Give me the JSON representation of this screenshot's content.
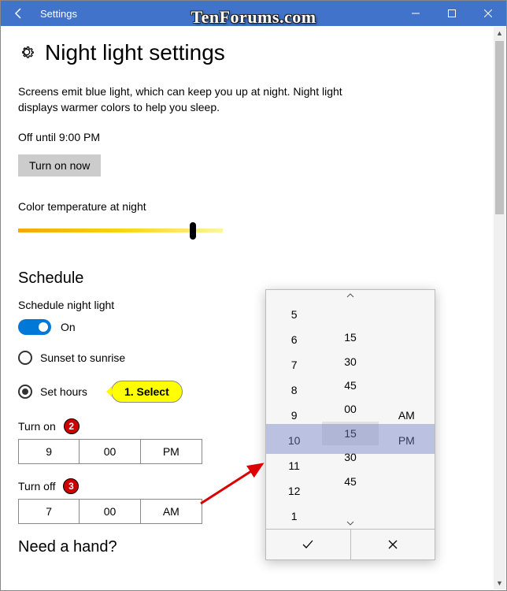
{
  "titlebar": {
    "title": "Settings"
  },
  "watermark": "TenForums.com",
  "page": {
    "title": "Night light settings",
    "description": "Screens emit blue light, which can keep you up at night. Night light displays warmer colors to help you sleep.",
    "status": "Off until 9:00 PM",
    "turn_on_button": "Turn on now",
    "color_temp_label": "Color temperature at night"
  },
  "schedule": {
    "heading": "Schedule",
    "toggle_label": "Schedule night light",
    "toggle_state": "On",
    "radio_sunset": "Sunset to sunrise",
    "radio_sethours": "Set hours",
    "callout": "1. Select",
    "turn_on": {
      "label": "Turn on",
      "badge": "2",
      "hour": "9",
      "minute": "00",
      "ampm": "PM"
    },
    "turn_off": {
      "label": "Turn off",
      "badge": "3",
      "hour": "7",
      "minute": "00",
      "ampm": "AM"
    }
  },
  "footer_question": "Need a hand?",
  "time_picker": {
    "hours": [
      "5",
      "6",
      "7",
      "8",
      "9",
      "10",
      "11",
      "12",
      "1"
    ],
    "minutes": [
      "",
      "15",
      "30",
      "45",
      "00",
      "15",
      "30",
      "45",
      ""
    ],
    "ampm": [
      "",
      "",
      "",
      "",
      "AM",
      "PM",
      "",
      "",
      ""
    ],
    "selected_index": 4,
    "hover_minute_index": 5
  }
}
